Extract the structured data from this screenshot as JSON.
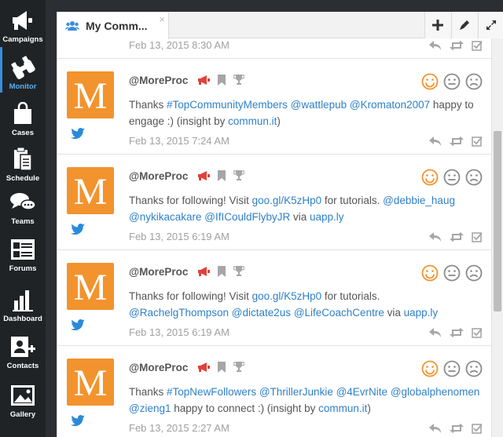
{
  "sidebar": {
    "items": [
      {
        "label": "Campaigns",
        "icon": "megaphone-icon"
      },
      {
        "label": "Monitor",
        "icon": "binoculars-icon"
      },
      {
        "label": "Cases",
        "icon": "shopping-bag-icon"
      },
      {
        "label": "Schedule",
        "icon": "clipboard-icon"
      },
      {
        "label": "Teams",
        "icon": "chat-bubbles-icon"
      },
      {
        "label": "Forums",
        "icon": "forum-board-icon"
      },
      {
        "label": "Dashboard",
        "icon": "bar-chart-icon"
      },
      {
        "label": "Contacts",
        "icon": "add-contact-icon"
      },
      {
        "label": "Gallery",
        "icon": "picture-icon"
      }
    ]
  },
  "tab": {
    "title": "My Comm...",
    "close": "×",
    "icon": "users-icon"
  },
  "toolbar": {
    "add": "add-icon",
    "edit": "pencil-icon",
    "expand": "expand-icon"
  },
  "previous": {
    "timestamp": "Feb 13, 2015 8:30 AM"
  },
  "posts": [
    {
      "author": "@MoreProc",
      "avatar_letter": "M",
      "timestamp": "Feb 13, 2015 7:24 AM",
      "parts": [
        {
          "t": "Thanks ",
          "l": false
        },
        {
          "t": "#TopCommunityMembers",
          "l": true
        },
        {
          "t": " ",
          "l": false
        },
        {
          "t": "@wattlepub",
          "l": true
        },
        {
          "t": " ",
          "l": false
        },
        {
          "t": "@Kromaton2007",
          "l": true
        },
        {
          "t": " happy to engage :) (insight by ",
          "l": false
        },
        {
          "t": "commun.it",
          "l": true
        },
        {
          "t": ")",
          "l": false
        }
      ]
    },
    {
      "author": "@MoreProc",
      "avatar_letter": "M",
      "timestamp": "Feb 13, 2015 6:19 AM",
      "parts": [
        {
          "t": "Thanks for following! Visit ",
          "l": false
        },
        {
          "t": "goo.gl/K5zHp0",
          "l": true
        },
        {
          "t": " for tutorials. ",
          "l": false
        },
        {
          "t": "@debbie_haug",
          "l": true
        },
        {
          "t": " ",
          "l": false
        },
        {
          "t": "@nykikacakare",
          "l": true
        },
        {
          "t": " ",
          "l": false
        },
        {
          "t": "@IfICouldFlybyJR",
          "l": true
        },
        {
          "t": " via ",
          "l": false
        },
        {
          "t": "uapp.ly",
          "l": true
        }
      ]
    },
    {
      "author": "@MoreProc",
      "avatar_letter": "M",
      "timestamp": "Feb 13, 2015 6:19 AM",
      "parts": [
        {
          "t": "Thanks for following! Visit ",
          "l": false
        },
        {
          "t": "goo.gl/K5zHp0",
          "l": true
        },
        {
          "t": " for tutorials. ",
          "l": false
        },
        {
          "t": "@RachelgThompson",
          "l": true
        },
        {
          "t": " ",
          "l": false
        },
        {
          "t": "@dictate2us",
          "l": true
        },
        {
          "t": " ",
          "l": false
        },
        {
          "t": "@LifeCoachCentre",
          "l": true
        },
        {
          "t": " via ",
          "l": false
        },
        {
          "t": "uapp.ly",
          "l": true
        }
      ]
    },
    {
      "author": "@MoreProc",
      "avatar_letter": "M",
      "timestamp": "Feb 13, 2015 2:27 AM",
      "parts": [
        {
          "t": "Thanks ",
          "l": false
        },
        {
          "t": "#TopNewFollowers",
          "l": true
        },
        {
          "t": " ",
          "l": false
        },
        {
          "t": "@ThrillerJunkie",
          "l": true
        },
        {
          "t": " ",
          "l": false
        },
        {
          "t": "@4EvrNite",
          "l": true
        },
        {
          "t": " ",
          "l": false
        },
        {
          "t": "@globalphenomen",
          "l": true
        },
        {
          "t": " ",
          "l": false
        },
        {
          "t": "@zieng1",
          "l": true
        },
        {
          "t": " happy to connect :) (insight by ",
          "l": false
        },
        {
          "t": "commun.it",
          "l": true
        },
        {
          "t": ")",
          "l": false
        }
      ]
    }
  ],
  "colors": {
    "sidebar_bg": "#1f2326",
    "active_accent": "#3a8dde",
    "link": "#2f80c8",
    "avatar": "#f2932e",
    "positive_sentiment": "#f2932e",
    "megaphone": "#e0413a",
    "twitter": "#2b8ad8"
  }
}
